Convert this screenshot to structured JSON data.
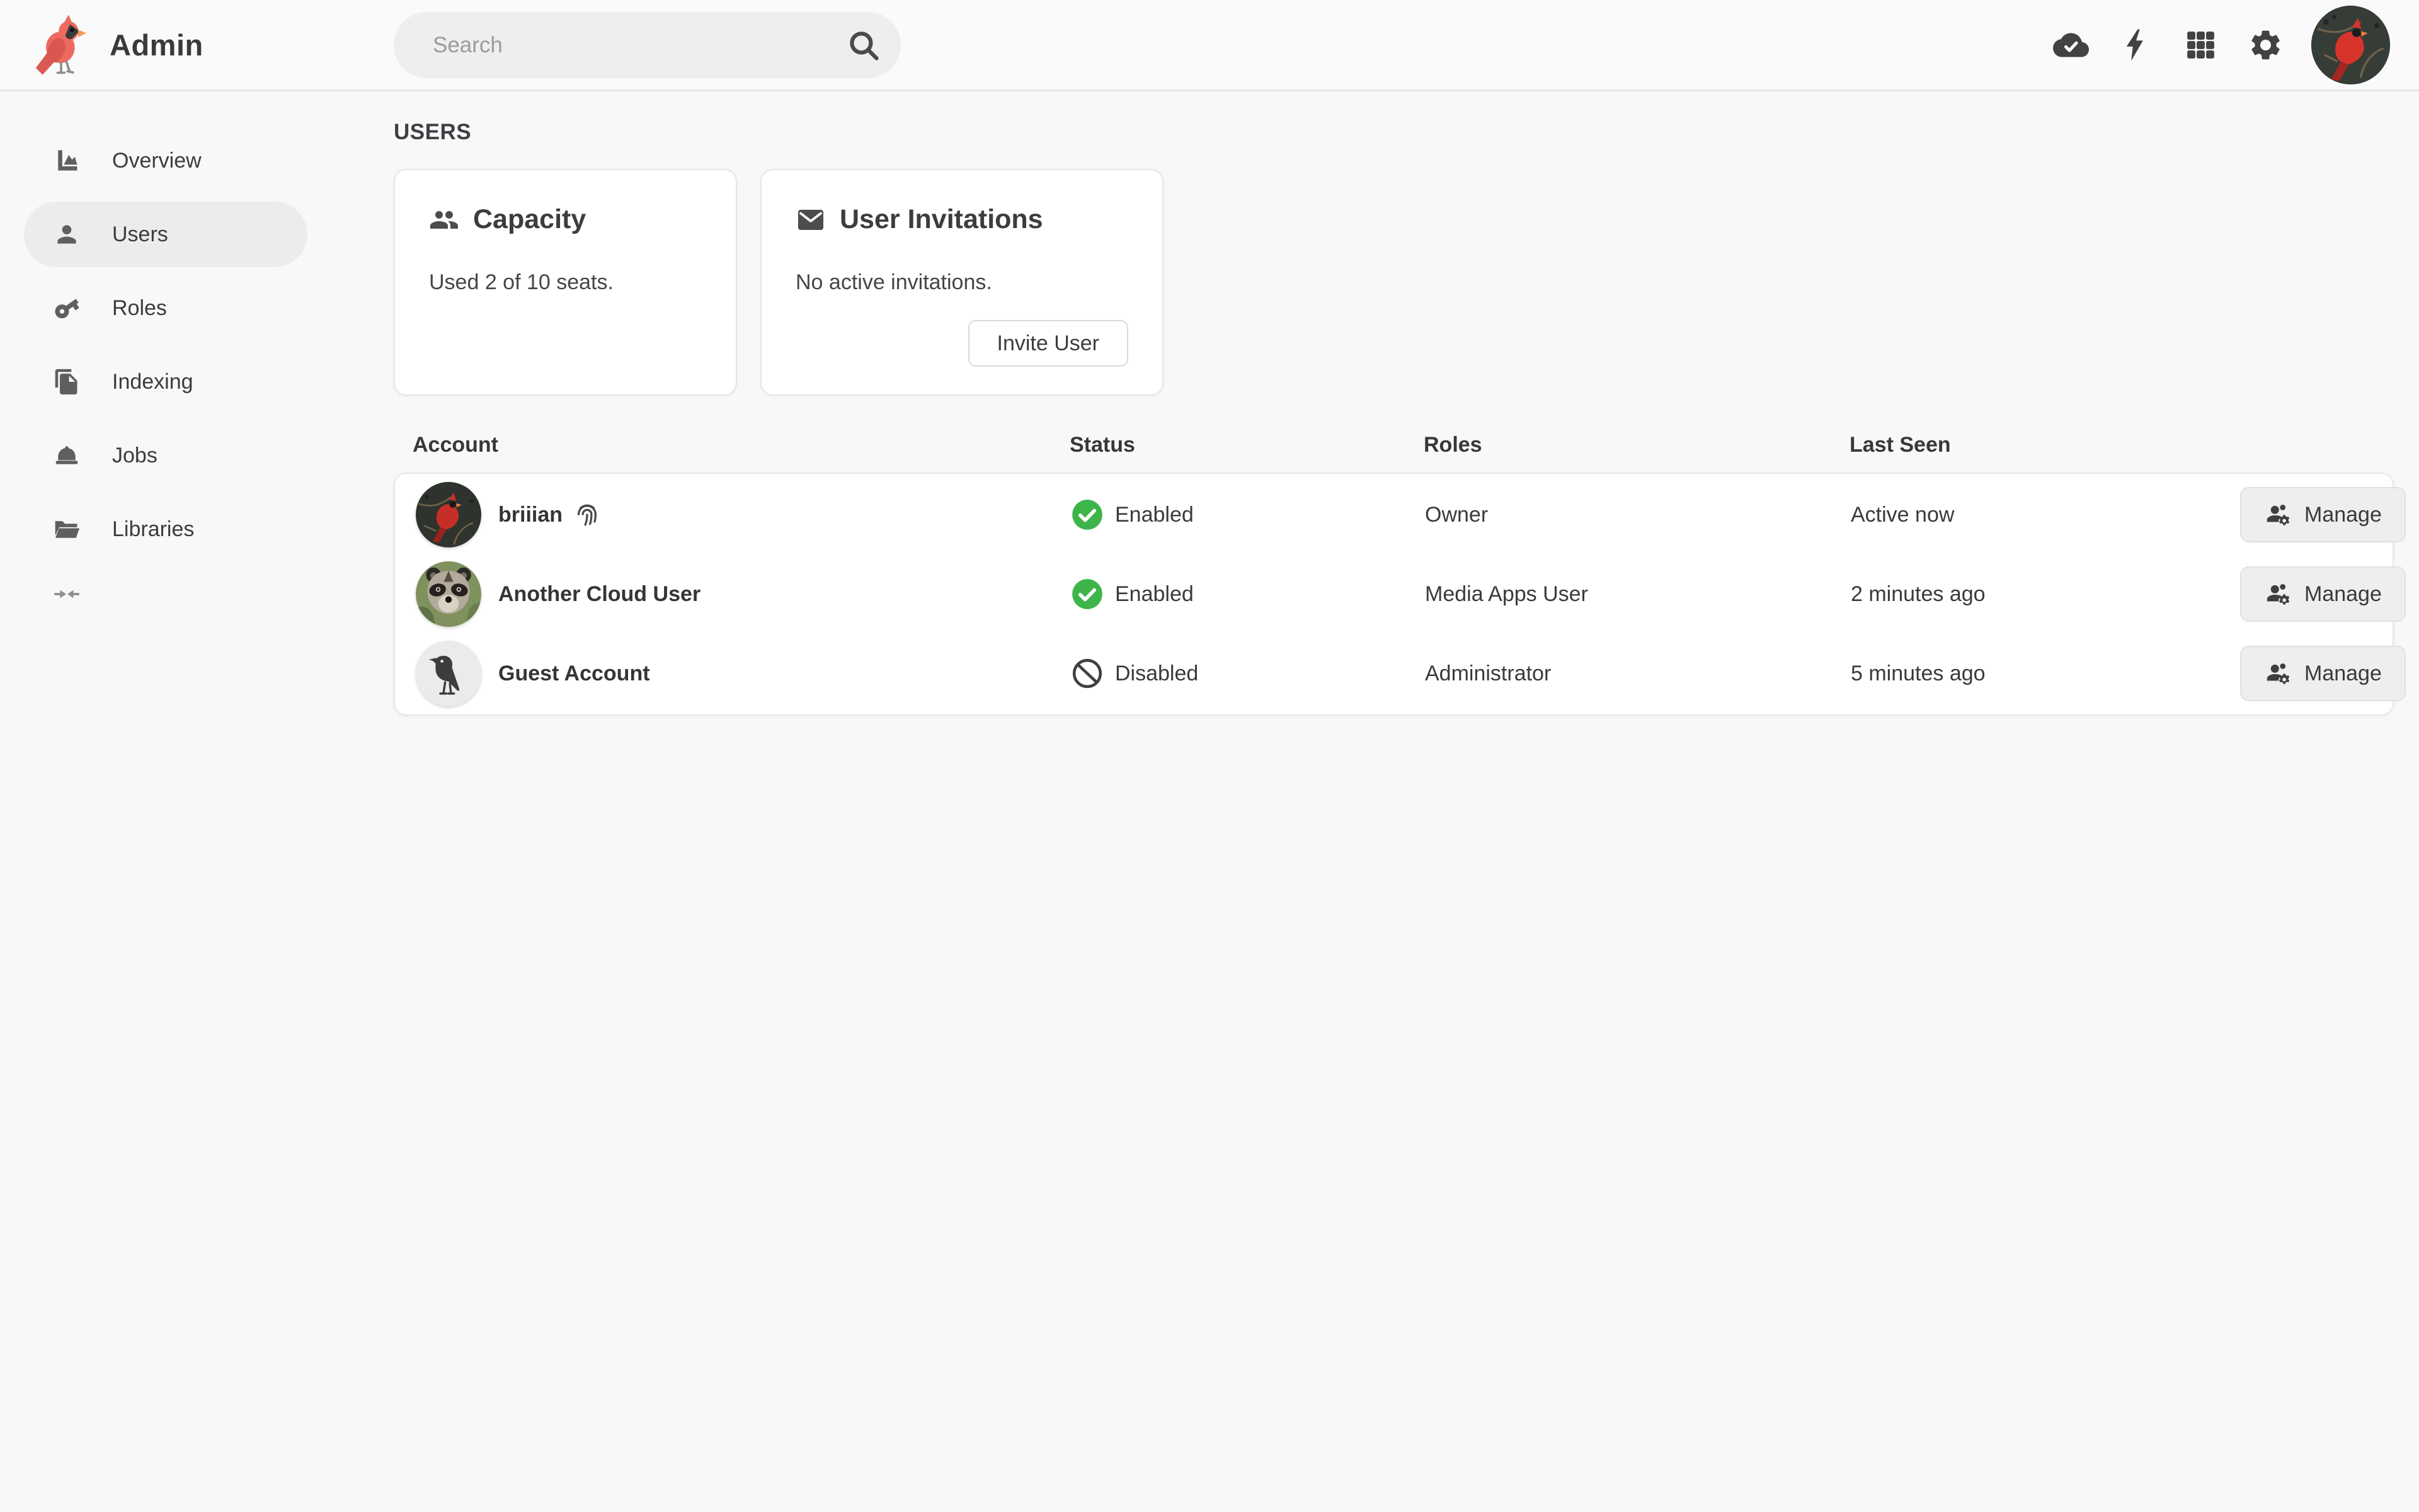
{
  "header": {
    "app_title": "Admin",
    "search": {
      "placeholder": "Search"
    },
    "icons": [
      "cloud-done",
      "bolt",
      "apps-grid",
      "settings-gear",
      "user-avatar"
    ]
  },
  "sidebar": {
    "items": [
      {
        "label": "Overview",
        "icon": "area-chart-icon"
      },
      {
        "label": "Users",
        "icon": "person-icon",
        "active": true
      },
      {
        "label": "Roles",
        "icon": "key-icon"
      },
      {
        "label": "Indexing",
        "icon": "copy-pages-icon"
      },
      {
        "label": "Jobs",
        "icon": "hard-hat-icon"
      },
      {
        "label": "Libraries",
        "icon": "open-folder-icon"
      }
    ],
    "collapse_icon": "collapse-arrows"
  },
  "page": {
    "section_title": "USERS",
    "cards": {
      "capacity": {
        "icon": "people-group-icon",
        "title": "Capacity",
        "body": "Used 2 of 10 seats."
      },
      "invitations": {
        "icon": "envelope-icon",
        "title": "User Invitations",
        "body": "No active invitations.",
        "button_label": "Invite User"
      }
    },
    "table": {
      "columns": [
        "Account",
        "Status",
        "Roles",
        "Last Seen"
      ],
      "manage_label": "Manage",
      "rows": [
        {
          "name": "briiian",
          "avatar": "cardinal-photo",
          "passkey_icon": "fingerprint-icon",
          "status": "Enabled",
          "roles": "Owner",
          "last_seen": "Active now"
        },
        {
          "name": "Another Cloud User",
          "avatar": "raccoon-photo",
          "status": "Enabled",
          "roles": "Media Apps User",
          "last_seen": "2 minutes ago"
        },
        {
          "name": "Guest Account",
          "avatar": "bird-silhouette",
          "status": "Disabled",
          "roles": "Administrator",
          "last_seen": "5 minutes ago"
        }
      ]
    }
  },
  "colors": {
    "status_enabled_green": "#3db54a",
    "brand_red": "#ee6a60",
    "page_background": "#f8f8f8",
    "card_background": "#ffffff"
  }
}
